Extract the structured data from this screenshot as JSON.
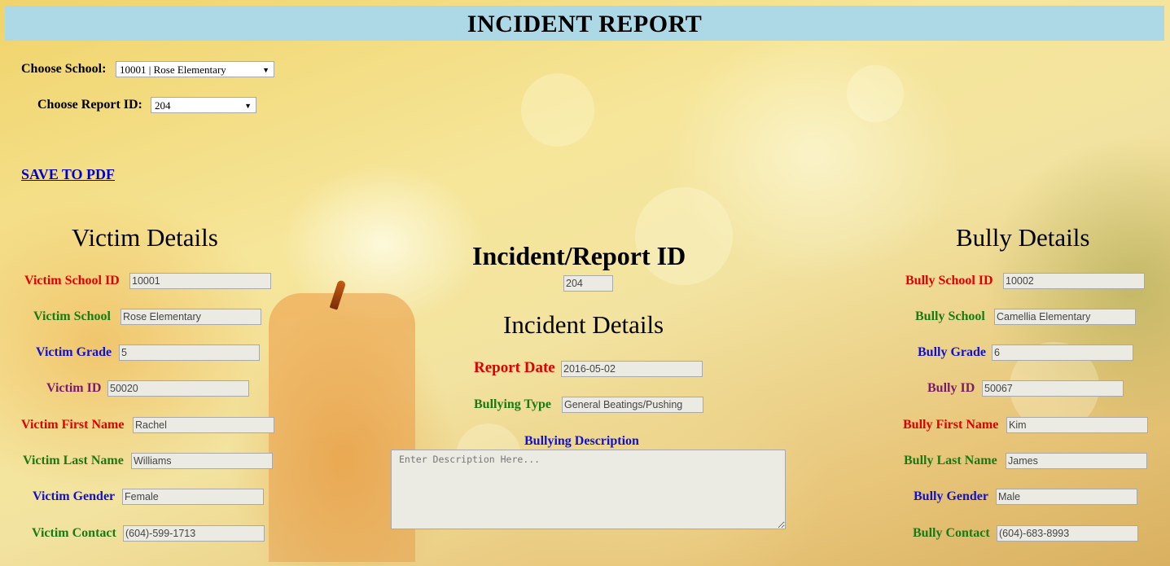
{
  "header": {
    "title": "INCIDENT REPORT"
  },
  "filters": {
    "school_label": "Choose School:",
    "school_value": "10001 | Rose Elementary",
    "report_label": "Choose Report ID:",
    "report_value": "204"
  },
  "save_pdf": "SAVE TO PDF",
  "victim": {
    "heading": "Victim Details",
    "fields": [
      {
        "label": "Victim School ID",
        "value": "10001",
        "color": "#e00000"
      },
      {
        "label": "Victim School",
        "value": "Rose Elementary",
        "color": "#1a7a14"
      },
      {
        "label": "Victim Grade",
        "value": "5",
        "color": "#1010d0"
      },
      {
        "label": "Victim ID",
        "value": "50020",
        "color": "#7a1a6a"
      },
      {
        "label": "Victim First Name",
        "value": "Rachel",
        "color": "#e00000"
      },
      {
        "label": "Victim Last Name",
        "value": "Williams",
        "color": "#1a7a14"
      },
      {
        "label": "Victim Gender",
        "value": "Female",
        "color": "#1010d0"
      },
      {
        "label": "Victim Contact",
        "value": "(604)-599-1713",
        "color": "#1a7a14"
      }
    ]
  },
  "incident": {
    "id_heading": "Incident/Report ID",
    "id_value": "204",
    "details_heading": "Incident Details",
    "report_date_label": "Report Date",
    "report_date_value": "2016-05-02",
    "bullying_type_label": "Bullying Type",
    "bullying_type_value": "General Beatings/Pushing",
    "description_label": "Bullying Description",
    "description_placeholder": "Enter Description Here..."
  },
  "bully": {
    "heading": "Bully Details",
    "fields": [
      {
        "label": "Bully School ID",
        "value": "10002",
        "color": "#e00000"
      },
      {
        "label": "Bully School",
        "value": "Camellia Elementary",
        "color": "#1a7a14"
      },
      {
        "label": "Bully Grade",
        "value": "6",
        "color": "#1010d0"
      },
      {
        "label": "Bully ID",
        "value": "50067",
        "color": "#7a1a6a"
      },
      {
        "label": "Bully First Name",
        "value": "Kim",
        "color": "#e00000"
      },
      {
        "label": "Bully Last Name",
        "value": "James",
        "color": "#1a7a14"
      },
      {
        "label": "Bully Gender",
        "value": "Male",
        "color": "#1010d0"
      },
      {
        "label": "Bully Contact",
        "value": "(604)-683-8993",
        "color": "#1a7a14"
      }
    ]
  }
}
